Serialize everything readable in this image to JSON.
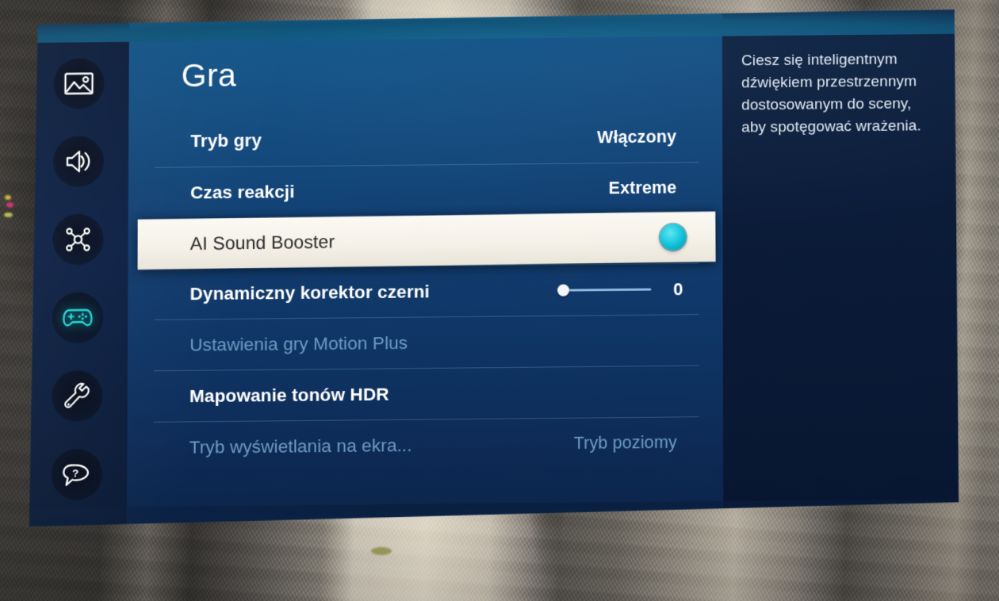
{
  "screen": {
    "title": "Gra"
  },
  "sidebar": {
    "items": [
      {
        "icon": "picture-icon",
        "name": "picture",
        "active": false
      },
      {
        "icon": "sound-icon",
        "name": "sound",
        "active": false
      },
      {
        "icon": "network-icon",
        "name": "network",
        "active": false
      },
      {
        "icon": "gamepad-icon",
        "name": "game",
        "active": true
      },
      {
        "icon": "wrench-icon",
        "name": "general",
        "active": false
      },
      {
        "icon": "help-icon",
        "name": "support",
        "active": false
      }
    ],
    "active_color": "#25d8dd"
  },
  "settings": {
    "rows": [
      {
        "id": "game-mode",
        "label": "Tryb gry",
        "value": "Włączony",
        "control": "value",
        "state": "enabled"
      },
      {
        "id": "response-time",
        "label": "Czas reakcji",
        "value": "Extreme",
        "control": "value",
        "state": "enabled"
      },
      {
        "id": "ai-sound-booster",
        "label": "AI Sound Booster",
        "value": "",
        "control": "toggle",
        "toggle_on": true,
        "toggle_color": "#18c8dc",
        "state": "focused"
      },
      {
        "id": "dynamic-black-equalizer",
        "label": "Dynamiczny korektor czerni",
        "value": "0",
        "control": "slider",
        "slider_value": 0,
        "slider_min": 0,
        "slider_max": 20,
        "state": "enabled"
      },
      {
        "id": "motion-plus-game-settings",
        "label": "Ustawienia gry Motion Plus",
        "value": "",
        "control": "none",
        "state": "disabled"
      },
      {
        "id": "hdr-tone-mapping",
        "label": "Mapowanie tonów HDR",
        "value": "",
        "control": "none",
        "state": "enabled"
      },
      {
        "id": "screen-display-mode",
        "label": "Tryb wyświetlania na ekra...",
        "value": "Tryb poziomy",
        "control": "value",
        "state": "disabled"
      }
    ]
  },
  "help": {
    "text": "Ciesz się inteligentnym dźwiękiem przestrzennym dostosowanym do sceny, aby spotęgować wrażenia."
  },
  "colors": {
    "panel_top": "#0f4f82",
    "panel_bottom": "#0b2349",
    "sidebar": "#0b1c39",
    "help_panel": "#0c1f3e",
    "focus_row": "#f7f4ec",
    "accent_cyan": "#18c8dc",
    "disabled_text": "#6e9cc4"
  }
}
